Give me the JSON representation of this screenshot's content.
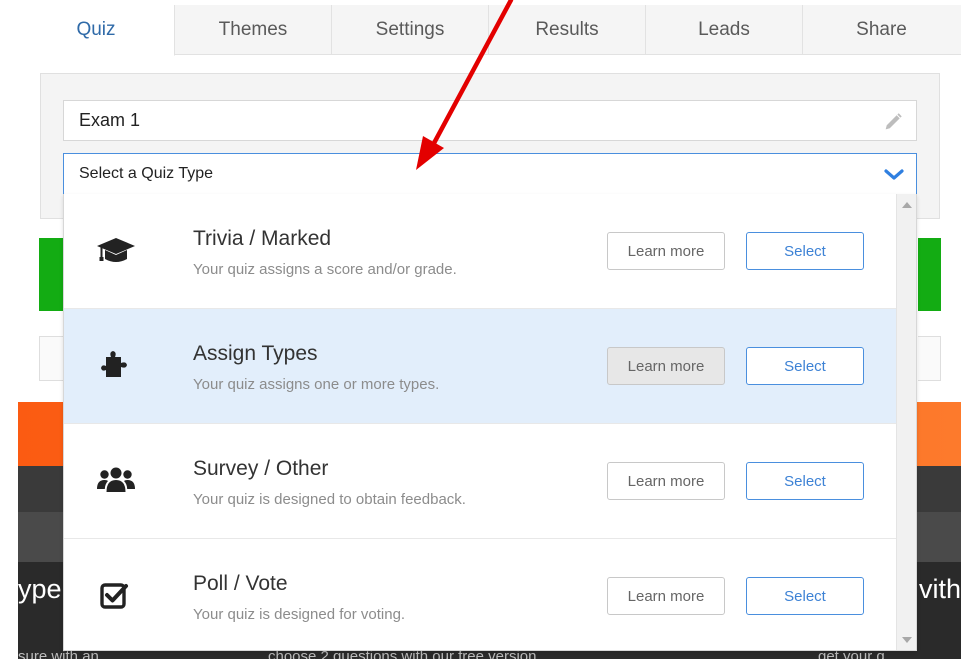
{
  "tabs": [
    {
      "label": "Quiz",
      "active": true
    },
    {
      "label": "Themes",
      "active": false
    },
    {
      "label": "Settings",
      "active": false
    },
    {
      "label": "Results",
      "active": false
    },
    {
      "label": "Leads",
      "active": false
    },
    {
      "label": "Share",
      "active": false
    }
  ],
  "quiz_title": {
    "value": "Exam 1",
    "icon": "pencil-icon"
  },
  "quiz_type_select": {
    "value": "Select a Quiz Type",
    "icon": "chevron-down-icon"
  },
  "quiz_types": [
    {
      "title": "Trivia / Marked",
      "description": "Your quiz assigns a score and/or grade.",
      "icon": "graduation-cap-icon",
      "learn_label": "Learn more",
      "select_label": "Select",
      "highlighted": false
    },
    {
      "title": "Assign Types",
      "description": "Your quiz assigns one or more types.",
      "icon": "puzzle-piece-icon",
      "learn_label": "Learn more",
      "select_label": "Select",
      "highlighted": true
    },
    {
      "title": "Survey / Other",
      "description": "Your quiz is designed to obtain feedback.",
      "icon": "users-icon",
      "learn_label": "Learn more",
      "select_label": "Select",
      "highlighted": false
    },
    {
      "title": "Poll / Vote",
      "description": "Your quiz is designed for voting.",
      "icon": "checkbox-icon",
      "learn_label": "Learn more",
      "select_label": "Select",
      "highlighted": false
    }
  ],
  "background": {
    "left_text": "ype",
    "right_text": "vith",
    "bottom_texts": [
      "sure with an",
      "choose 2 questions with our free version",
      "get your q"
    ]
  },
  "colors": {
    "accent_blue": "#4a8fde",
    "active_tab": "#2f6aa8",
    "green": "#13ac13",
    "orange": "#fb5b12",
    "arrow": "#e30000"
  }
}
